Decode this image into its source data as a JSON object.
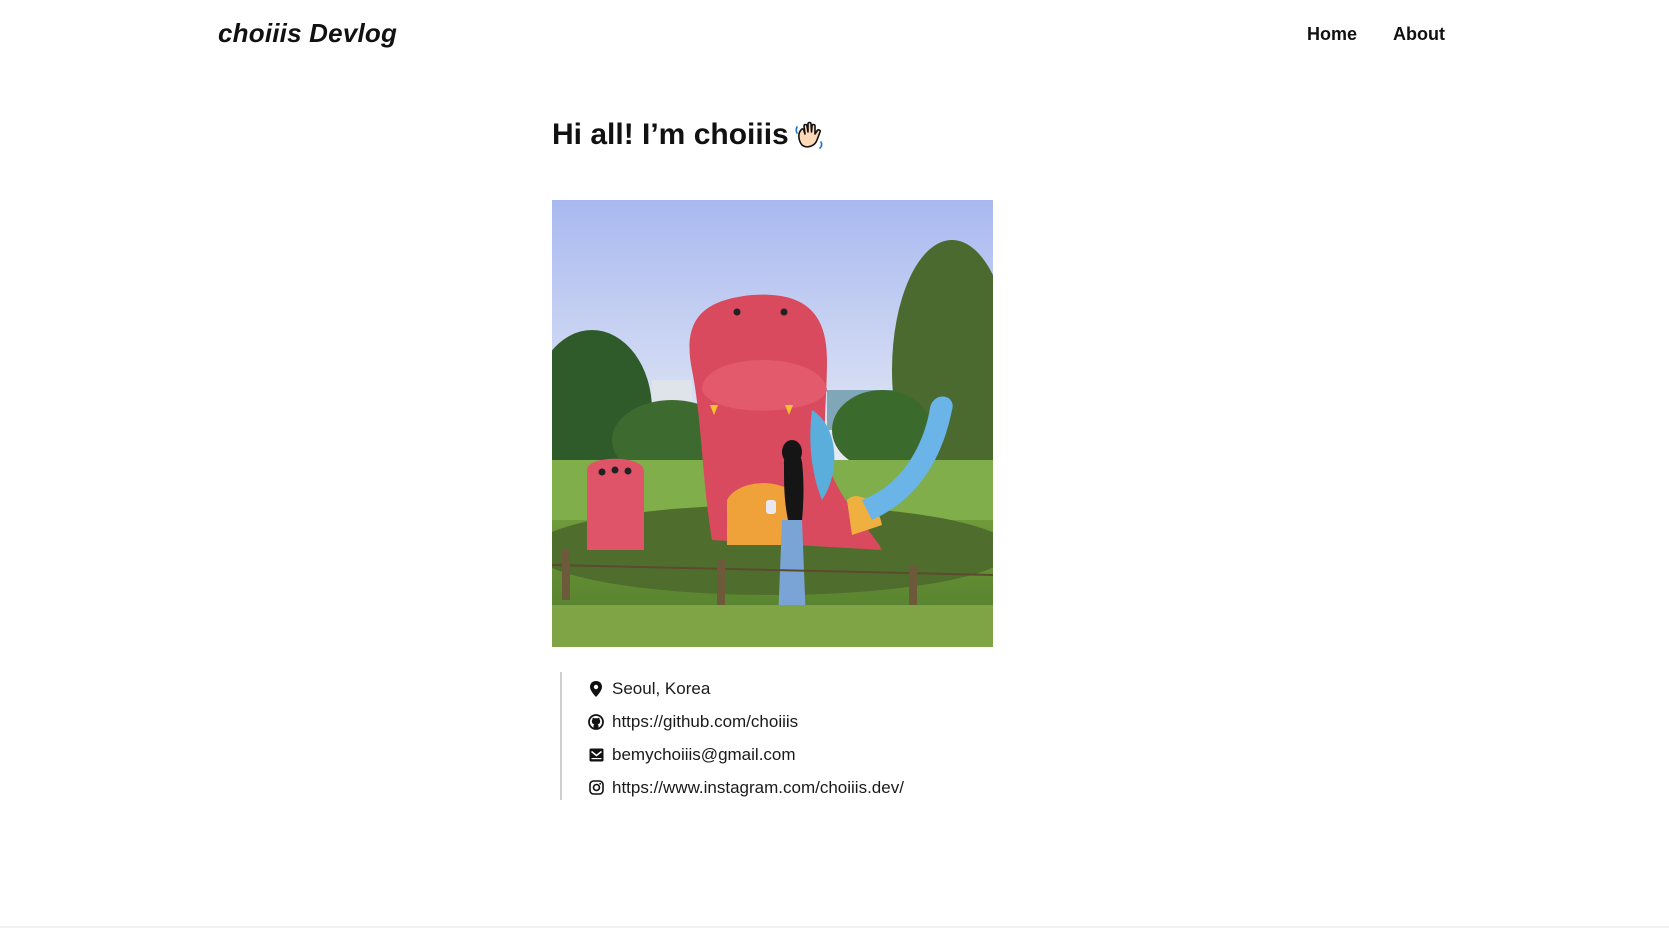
{
  "header": {
    "site_title": "choiiis Devlog",
    "nav": [
      {
        "label": "Home"
      },
      {
        "label": "About"
      }
    ]
  },
  "main": {
    "greeting": "Hi all! I’m choiiis",
    "greeting_icon": "waving-hand-icon",
    "photo_icon": "profile-photo",
    "info": [
      {
        "icon": "map-pin-icon",
        "text": "Seoul, Korea"
      },
      {
        "icon": "github-icon",
        "text": "https://github.com/choiiis"
      },
      {
        "icon": "mail-icon",
        "text": "bemychoiiis@gmail.com"
      },
      {
        "icon": "instagram-icon",
        "text": "https://www.instagram.com/choiiis.dev/"
      }
    ]
  },
  "colors": {
    "text": "#111111",
    "background": "#ffffff",
    "divider": "#cfcfcf"
  }
}
